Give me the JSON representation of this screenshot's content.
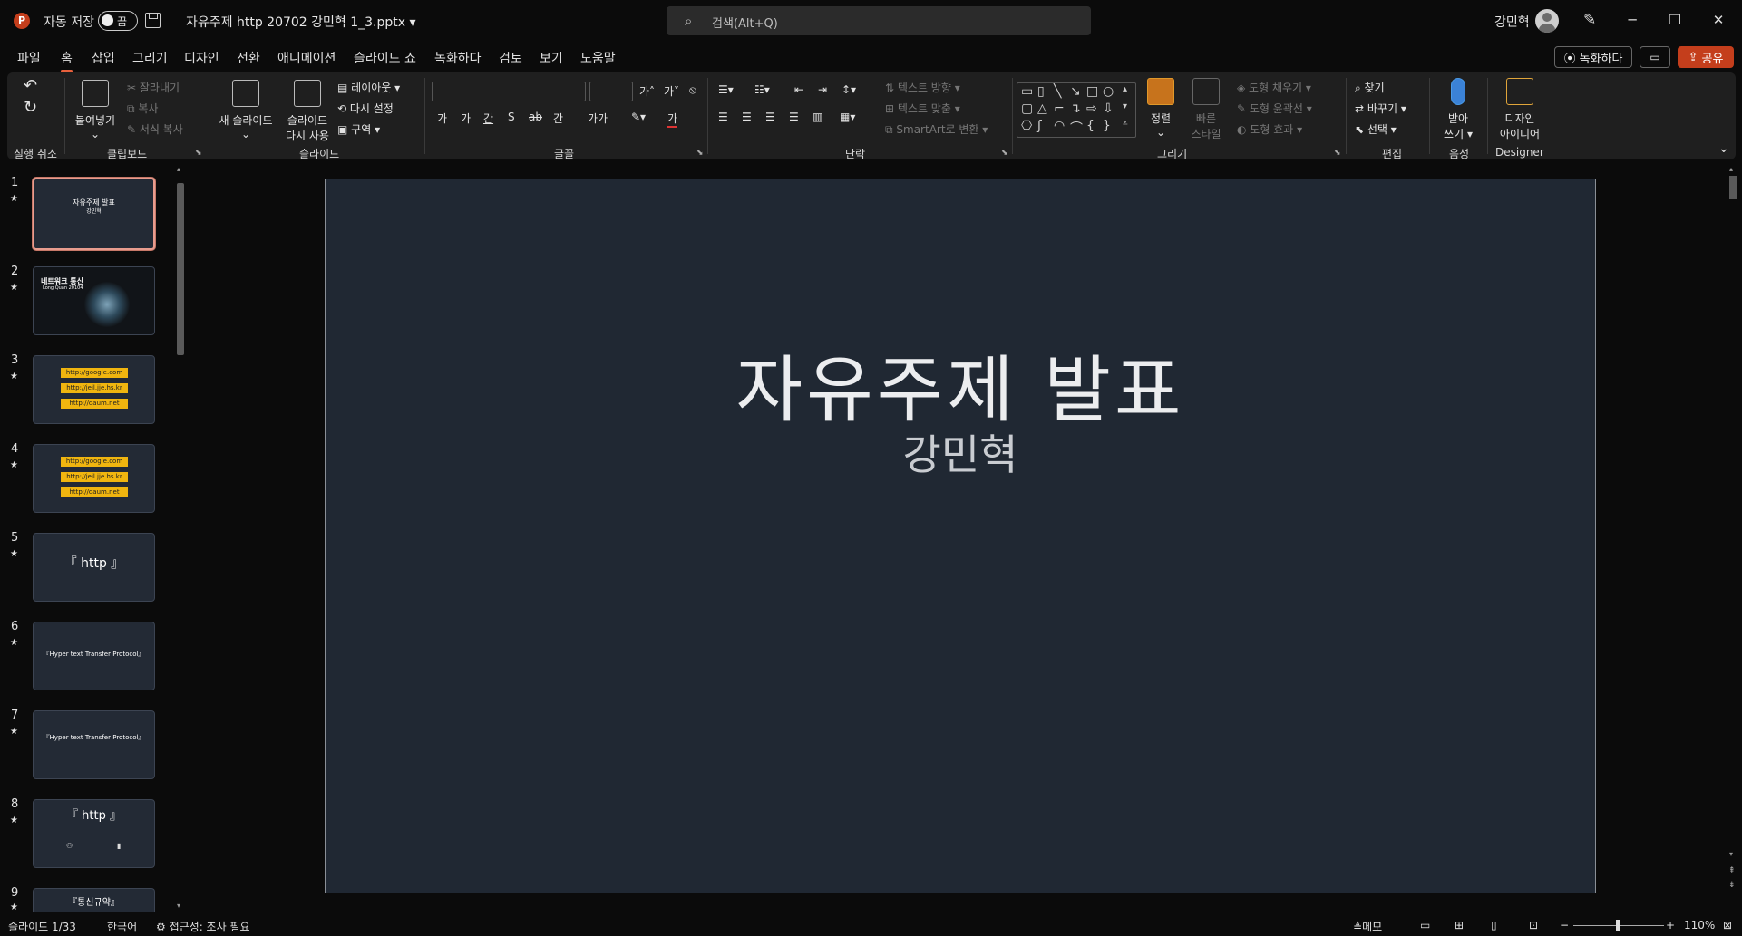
{
  "titlebar": {
    "app_icon": "P",
    "autosave_label": "자동 저장",
    "autosave_state": "끔",
    "doc_title": "자유주제 http 20702 강민혁 1_3.pptx",
    "search_placeholder": "검색(Alt+Q)",
    "user_name": "강민혁",
    "minimize": "─",
    "restore": "❐",
    "close": "✕"
  },
  "menu": {
    "tabs": [
      "파일",
      "홈",
      "삽입",
      "그리기",
      "디자인",
      "전환",
      "애니메이션",
      "슬라이드 쇼",
      "녹화하다",
      "검토",
      "보기",
      "도움말"
    ],
    "record_button": "녹화하다",
    "comment_button": "▭",
    "share_button": "공유"
  },
  "ribbon": {
    "undo_group": "실행 취소",
    "clipboard_group": "클립보드",
    "paste": "붙여넣기",
    "cut": "잘라내기",
    "copy": "복사",
    "format_painter": "서식 복사",
    "slides_group": "슬라이드",
    "new_slide": "새 슬라이드",
    "reuse_slide_1": "슬라이드",
    "reuse_slide_2": "다시 사용",
    "layout": "레이아웃",
    "reset": "다시 설정",
    "section": "구역",
    "font_group": "글꼴",
    "paragraph_group": "단락",
    "text_direction": "텍스트 방향",
    "align_text": "텍스트 맞춤",
    "smartart": "SmartArt로 변환",
    "drawing_group": "그리기",
    "arrange": "정렬",
    "quick_styles_1": "빠른",
    "quick_styles_2": "스타일",
    "shape_fill": "도형 채우기",
    "shape_outline": "도형 윤곽선",
    "shape_effects": "도형 효과",
    "editing_group": "편집",
    "find": "찾기",
    "replace": "바꾸기",
    "select": "선택",
    "voice_group": "음성",
    "dictate_1": "받아",
    "dictate_2": "쓰기",
    "designer_group": "Designer",
    "design_ideas_1": "디자인",
    "design_ideas_2": "아이디어",
    "font_buttons": [
      "가",
      "가",
      "간",
      "S",
      "ab",
      "간",
      "가가"
    ]
  },
  "thumbnails": [
    {
      "num": "1",
      "title": "자유주제 발표",
      "sub": "강민혁"
    },
    {
      "num": "2",
      "title": "네트워크 통신",
      "sub": "Long Quan 20104"
    },
    {
      "num": "3",
      "pills": [
        "http://google.com",
        "http://jeil.jje.hs.kr",
        "http://daum.net"
      ]
    },
    {
      "num": "4",
      "pills": [
        "http://google.com",
        "http://jeil.jje.hs.kr",
        "http://daum.net"
      ]
    },
    {
      "num": "5",
      "title": "『 http 』"
    },
    {
      "num": "6",
      "title": "『Hyper text Transfer Protocol』"
    },
    {
      "num": "7",
      "title": "『Hyper text Transfer Protocol』"
    },
    {
      "num": "8",
      "title": "『 http 』"
    },
    {
      "num": "9",
      "title": "『통신규약』"
    }
  ],
  "slide": {
    "title": "자유주제 발표",
    "subtitle": "강민혁"
  },
  "status": {
    "slide_counter": "슬라이드 1/33",
    "language": "한국어",
    "accessibility": "접근성: 조사 필요",
    "notes": "메모",
    "zoom": "110%"
  }
}
